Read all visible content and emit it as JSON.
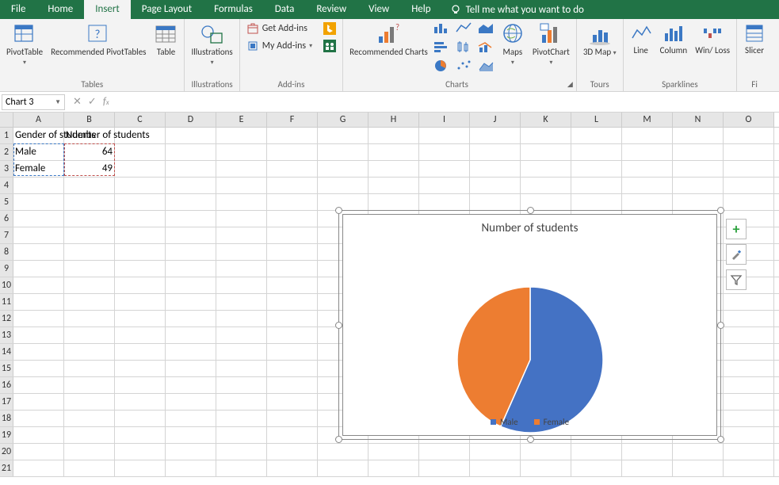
{
  "menu": {
    "tabs": [
      "File",
      "Home",
      "Insert",
      "Page Layout",
      "Formulas",
      "Data",
      "Review",
      "View",
      "Help"
    ],
    "active": 2,
    "tell": "Tell me what you want to do"
  },
  "ribbon": {
    "groups": {
      "tables": {
        "label": "Tables",
        "pivot": "PivotTable",
        "rec": "Recommended PivotTables",
        "table": "Table"
      },
      "illus": {
        "label": "Illustrations",
        "btn": "Illustrations"
      },
      "addins": {
        "label": "Add-ins",
        "get": "Get Add-ins",
        "my": "My Add-ins"
      },
      "charts": {
        "label": "Charts",
        "rec": "Recommended Charts",
        "maps": "Maps",
        "pivotchart": "PivotChart"
      },
      "tours": {
        "label": "Tours",
        "map3d": "3D Map"
      },
      "spark": {
        "label": "Sparklines",
        "line": "Line",
        "column": "Column",
        "winloss": "Win/ Loss"
      },
      "filters": {
        "label": "Fi",
        "slicer": "Slicer"
      }
    }
  },
  "fx": {
    "name": "Chart 3",
    "formula": ""
  },
  "sheet": {
    "cols": [
      "A",
      "B",
      "C",
      "D",
      "E",
      "F",
      "G",
      "H",
      "I",
      "J",
      "K",
      "L",
      "M",
      "N",
      "O"
    ],
    "rows": 21,
    "a1": "Gender of students",
    "b1": "Number of students",
    "a2": "Male",
    "b2": "64",
    "a3": "Female",
    "b3": "49"
  },
  "chart_data": {
    "type": "pie",
    "title": "Number of students",
    "categories": [
      "Male",
      "Female"
    ],
    "values": [
      64,
      49
    ],
    "colors": [
      "#4472c4",
      "#ed7d31"
    ],
    "legend_position": "bottom"
  },
  "chart_side": {
    "add": "+",
    "style": "brush",
    "filter": "funnel"
  }
}
